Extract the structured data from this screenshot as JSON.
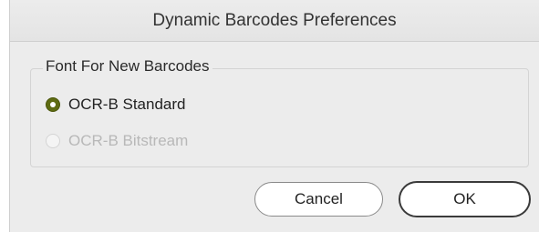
{
  "window": {
    "title": "Dynamic Barcodes Preferences"
  },
  "group": {
    "title": "Font For New Barcodes",
    "options": [
      {
        "label": "OCR-B Standard",
        "selected": true,
        "enabled": true
      },
      {
        "label": "OCR-B Bitstream",
        "selected": false,
        "enabled": false
      }
    ]
  },
  "buttons": {
    "cancel_label": "Cancel",
    "ok_label": "OK"
  },
  "colors": {
    "radio_selected": "#5e6b12",
    "dialog_background": "#ececec",
    "disabled_text": "#b8b8b8"
  }
}
